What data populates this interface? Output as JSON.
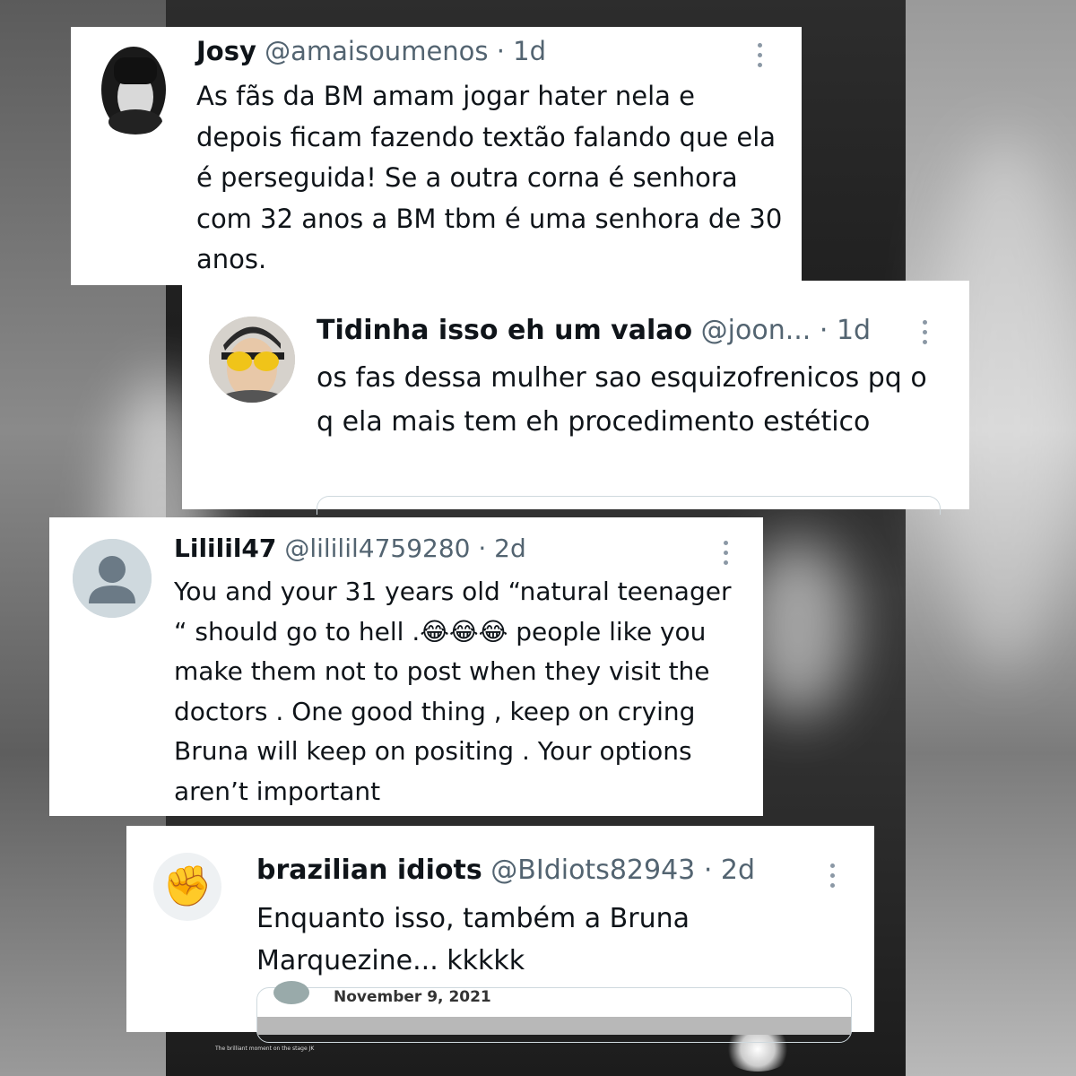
{
  "replies": [
    {
      "name": "Josy",
      "handle": "@amaisoumenos",
      "time": "· 1d",
      "text": "As fãs da BM amam jogar hater nela e depois ficam fazendo textão falando que ela é perseguida! Se a outra corna é senhora com 32 anos a BM tbm é uma senhora de 30 anos.",
      "avatar_icon": "woman-bangs-portrait"
    },
    {
      "name": "Tidinha isso eh um valao",
      "handle": "@joon...",
      "time": "· 1d",
      "text": "os fas dessa mulher sao esquizofrenicos pq o q ela mais tem eh procedimento estético",
      "avatar_icon": "person-yellow-sunglasses"
    },
    {
      "name": "Lililil47",
      "handle": "@lililil4759280",
      "time": "· 2d",
      "text": "You and your 31 years old “natural teenager “ should go to hell .😂😂😂 people like you make them not to post when they visit the doctors . One good thing , keep on crying Bruna will keep on positing . Your options aren’t important",
      "avatar_icon": "default-user-icon"
    },
    {
      "name": "brazilian idiots",
      "handle": "@BIdiots82943",
      "time": "· 2d",
      "text": "Enquanto isso, também a Bruna Marquezine... kkkkk",
      "avatar_icon": "raised-fist-emoji",
      "avatar_glyph": "✊",
      "quote_date": "November 9, 2021"
    }
  ],
  "caption": "The brilliant moment on the stage JK",
  "colors": {
    "name": "#0f1419",
    "meta": "#536471",
    "card": "#ffffff"
  }
}
